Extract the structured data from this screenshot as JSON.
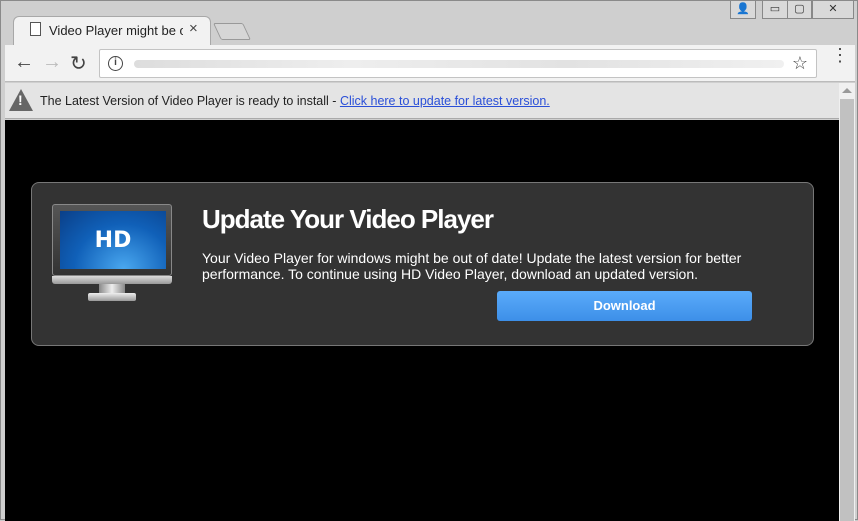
{
  "tab": {
    "title": "Video Player might be out of date",
    "close": "×"
  },
  "window": {
    "profile": "👤",
    "minimize": "▭",
    "restore": "▢",
    "close": "✕"
  },
  "toolbar": {
    "back": "←",
    "forward": "→",
    "reload": "↻",
    "info": "i",
    "star": "☆",
    "menu": "⋮"
  },
  "infobar": {
    "text": "The Latest Version of Video Player is ready to install - ",
    "link": "Click here to update for latest version.",
    "icon": "!"
  },
  "card": {
    "monitor_label": "HD",
    "title": "Update Your Video Player",
    "description": "Your Video Player for windows might be out of date! Update the latest version for better performance. To continue using HD Video Player, download an updated version.",
    "button": "Download"
  },
  "colors": {
    "accent": "#4a9ff5",
    "card_bg": "#333333",
    "content_bg": "#000000"
  }
}
